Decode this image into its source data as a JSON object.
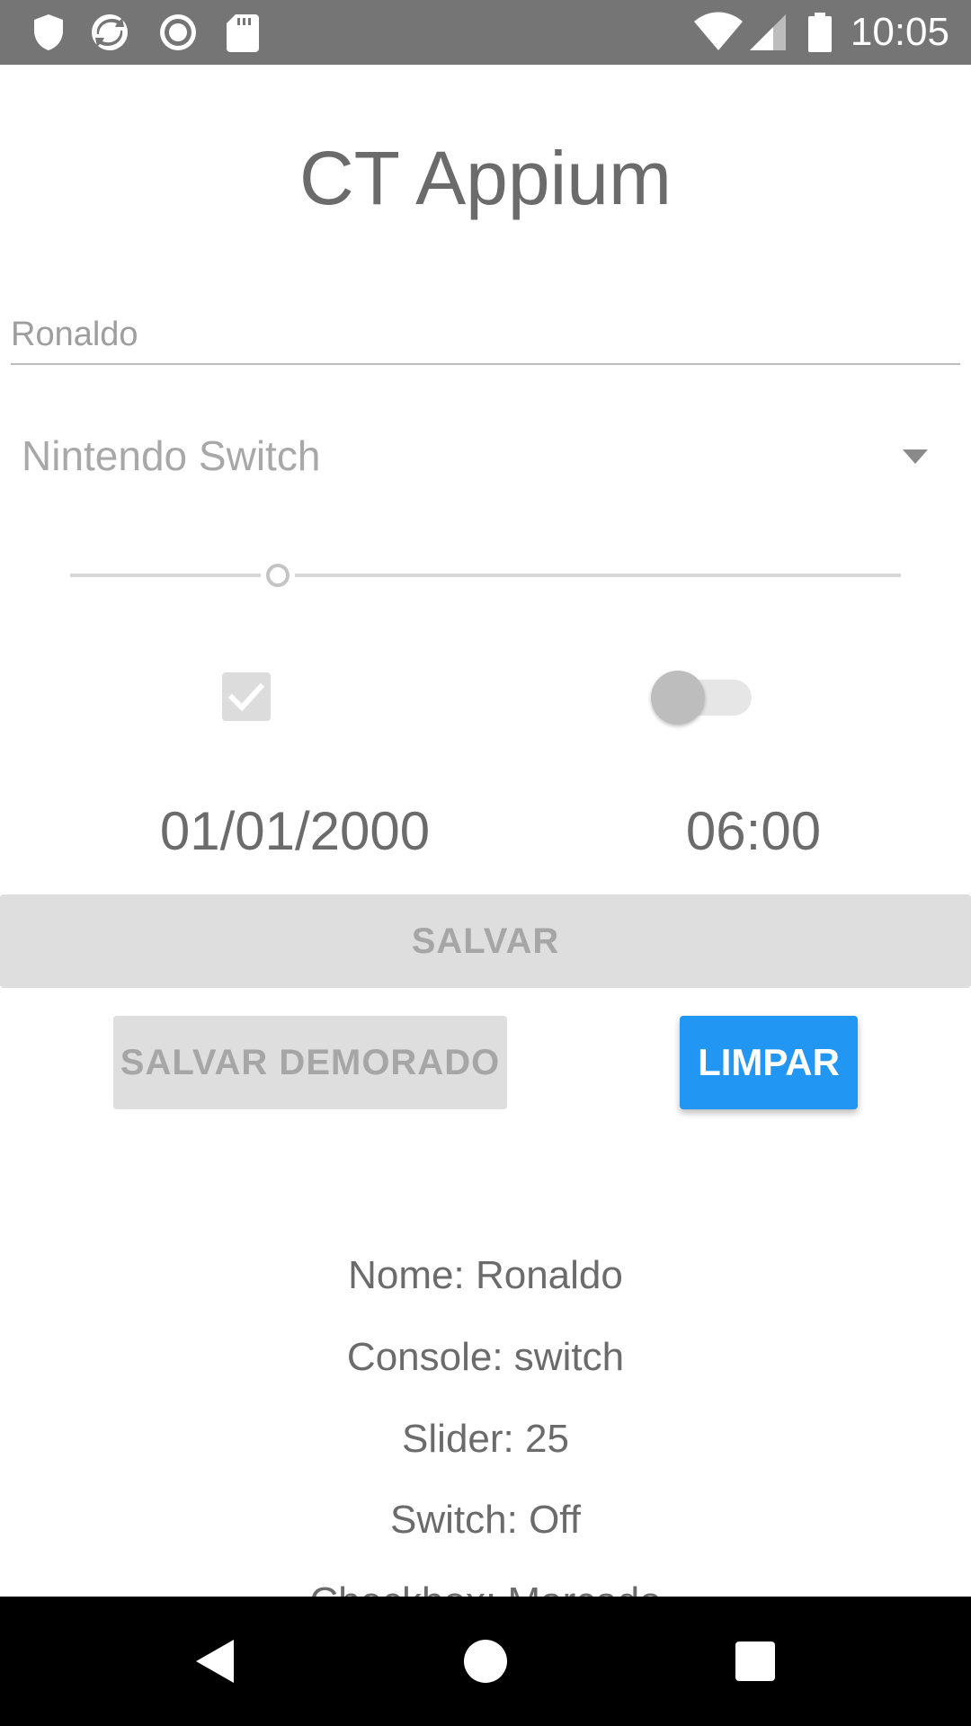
{
  "status_bar": {
    "time": "10:05",
    "left_icons": [
      "shield-icon",
      "sync-icon",
      "record-icon",
      "sd-card-icon"
    ],
    "right_icons": [
      "wifi-icon",
      "signal-icon",
      "battery-icon"
    ]
  },
  "app": {
    "title": "CT Appium"
  },
  "form": {
    "name_value": "Ronaldo",
    "console_selected": "Nintendo Switch",
    "slider_value_fraction": 0.25,
    "checkbox_checked": true,
    "switch_on": false,
    "date": "01/01/2000",
    "time": "06:00"
  },
  "buttons": {
    "save": "SALVAR",
    "save_delayed": "SALVAR DEMORADO",
    "clear": "LIMPAR"
  },
  "results": {
    "name": "Nome: Ronaldo",
    "console": "Console: switch",
    "slider": "Slider: 25",
    "switch": "Switch: Off",
    "checkbox": "Checkbox: Marcado"
  },
  "colors": {
    "status_bar": "#757575",
    "primary": "#2196f3",
    "disabled_button": "#dedede",
    "nav_bar": "#000000"
  }
}
